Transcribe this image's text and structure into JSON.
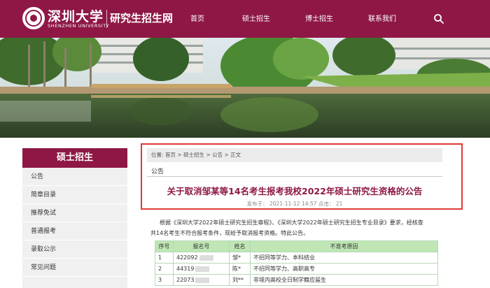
{
  "header": {
    "logo_cn": "深圳大学",
    "logo_en": "SHENZHEN UNIVERSITY",
    "site_title": "研究生招生网",
    "nav": [
      "首页",
      "硕士招生",
      "博士招生",
      "联系我们"
    ],
    "search_icon": "search-icon",
    "bg_color": "#8e1745"
  },
  "sidebar": {
    "title": "硕士招生",
    "items": [
      "公告",
      "简章目录",
      "推荐免试",
      "普通报考",
      "录取公示",
      "常见问题"
    ]
  },
  "breadcrumb": {
    "prefix": "位置:",
    "items": [
      "首页",
      "硕士招生",
      "公告",
      "正文"
    ],
    "sep": ">"
  },
  "section_tag": "公告",
  "article": {
    "title": "关于取消邹某等14名考生报考我校2022年硕士研究生资格的公告",
    "meta": "发布于：  2021-11-12 14:57 点击：  21",
    "paragraph_1": "根据《深圳大学2022年硕士研究生招生章程》、《深圳大学2022年硕士研究生招生专业目录》要求，经核查",
    "paragraph_2": "共14名考生不符合报考条件，现给予取消报考资格。特此公告。"
  },
  "table": {
    "headers": [
      "序号",
      "报名号",
      "姓名",
      "不准考原因"
    ],
    "rows": [
      [
        "1",
        "422092",
        "邹*",
        "不招同等学力、本科结业"
      ],
      [
        "2",
        "44319",
        "陈*",
        "不招同等学力、高职高专"
      ],
      [
        "3",
        "22073",
        "刘**",
        "非境内高校全日制学籍应届生"
      ]
    ]
  },
  "colors": {
    "accent": "#8e1745",
    "highlight": "#e03a35",
    "table_header": "#bfe6b4"
  }
}
